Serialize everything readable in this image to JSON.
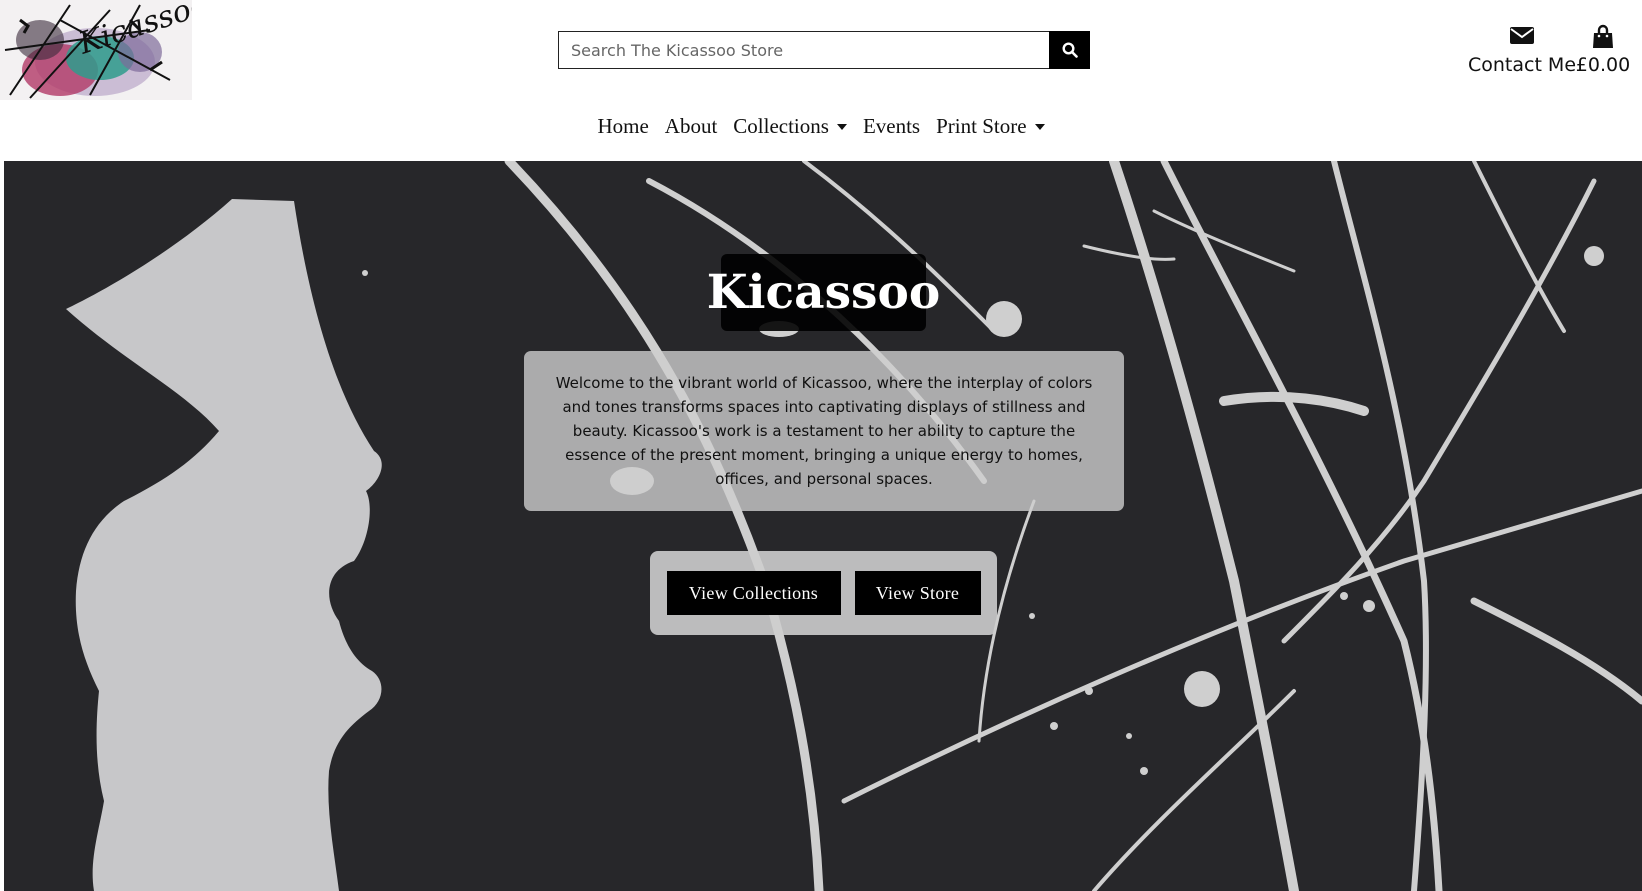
{
  "header": {
    "logo_text": "Kicassoo.",
    "search": {
      "placeholder": "Search The Kicassoo Store",
      "icon": "search-icon"
    },
    "contact": {
      "label": "Contact Me",
      "icon": "envelope-icon"
    },
    "bag": {
      "label": "£0.00",
      "icon": "shopping-bag-icon"
    }
  },
  "nav": {
    "items": [
      {
        "label": "Home"
      },
      {
        "label": "About"
      },
      {
        "label": "Collections",
        "icon": "chevron-down-icon"
      },
      {
        "label": "Events"
      },
      {
        "label": "Print Store",
        "icon": "chevron-down-icon"
      }
    ]
  },
  "hero": {
    "title": "Kicassoo",
    "text": "Welcome to the vibrant world of Kicassoo, where the interplay of colors and tones transforms spaces into captivating displays of stillness and beauty. Kicassoo's work is a testament to her ability to capture the essence of the present moment, bringing a unique energy to homes, offices, and personal spaces.",
    "buttons": {
      "collections": "View Collections",
      "store": "View Store"
    }
  },
  "colors": {
    "accent": "#000000",
    "hero_bg": "#27272a",
    "paint": "#c8c8c8"
  }
}
